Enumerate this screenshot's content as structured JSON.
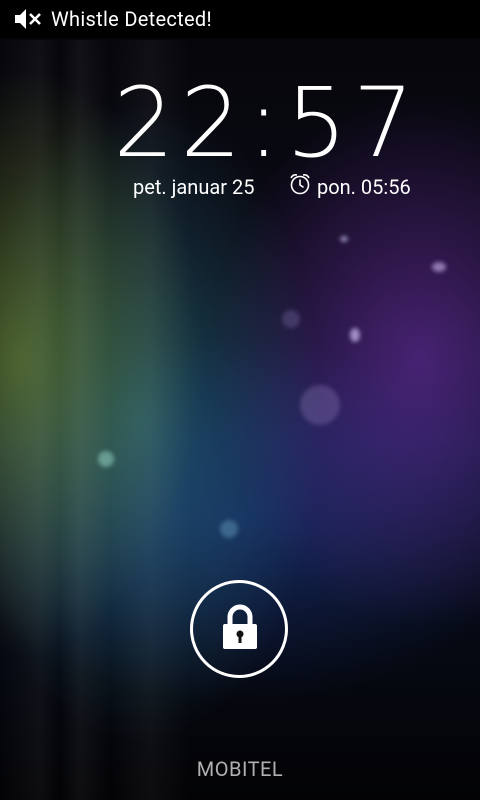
{
  "status_bar": {
    "notification_text": "Whistle Detected!",
    "icon": "volume-muted-icon"
  },
  "lockscreen": {
    "time": "22:57",
    "date": "pet. januar 25",
    "alarm": "pon. 05:56",
    "alarm_icon": "alarm-clock-icon",
    "lock_icon": "padlock-icon",
    "carrier": "MOBITEL"
  },
  "colors": {
    "text": "#ffffff",
    "carrier_text": "#b0b0b0",
    "status_bar_bg": "#000000"
  }
}
